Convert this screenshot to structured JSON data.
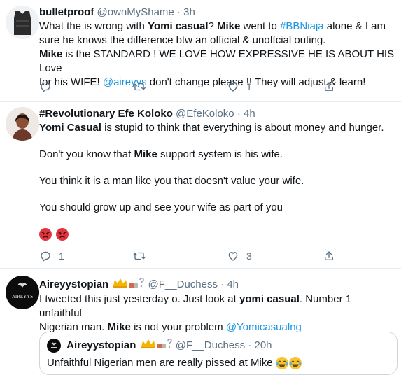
{
  "tweets": [
    {
      "name": "bulletproof",
      "handle": "@ownMyShame",
      "time": "3h",
      "lines": {
        "l1a": "What the  is wrong with ",
        "l1b": "Yomi casual",
        "l1c": "?  ",
        "l1d": "Mike",
        "l1e": " went to ",
        "l1f": "#BBNiaja",
        "l1g": " alone & I am",
        "l2": "sure he knows the difference btw an official & unoffcial outing.",
        "l3a": "Mike",
        "l3b": " is the STANDARD ! WE LOVE HOW EXPRESSIVE HE IS ABOUT HIS Love",
        "l4a": "for his WIFE! ",
        "l4b": "@aireyys",
        "l4c": " don't change please !! They will adjust & learn!"
      },
      "actions": {
        "reply": "",
        "retweet": "",
        "like": "1",
        "share": ""
      }
    },
    {
      "name": "#Revolutionary Efe Koloko",
      "handle": "@EfeKoloko",
      "time": "4h",
      "lines": {
        "l1a": "Yomi Casual",
        "l1b": " is stupid to think that everything is about money and hunger.",
        "l2a": "Don't you know that ",
        "l2b": "Mike",
        "l2c": "  support system is his wife.",
        "l3": "You think it is a man like you that doesn't value your wife.",
        "l4": "You should grow up and see your wife as part of you"
      },
      "emoji": [
        "angry-face",
        "angry-face"
      ],
      "actions": {
        "reply": "1",
        "retweet": "",
        "like": "3",
        "share": ""
      }
    },
    {
      "name": "Aireyystopian",
      "handle": "@F__Duchess",
      "time": "4h",
      "avatar_label": "AIREYYS",
      "lines": {
        "l1a": "I tweeted this just yesterday o. Just look at ",
        "l1b": "yomi casual",
        "l1c": ". Number 1 unfaithful",
        "l2a": "Nigerian man. ",
        "l2b": "Mike",
        "l2c": " is not your problem ",
        "l2d": "@Yomicasualng"
      },
      "quote": {
        "name": "Aireyystopian",
        "handle": "@F__Duchess",
        "time": "20h",
        "text": "Unfaithful Nigerian men are really pissed at Mike"
      }
    }
  ],
  "separator": "·",
  "colors": {
    "link": "#1b95e0",
    "secondary": "#5b7083",
    "border": "#e6ecf0"
  }
}
